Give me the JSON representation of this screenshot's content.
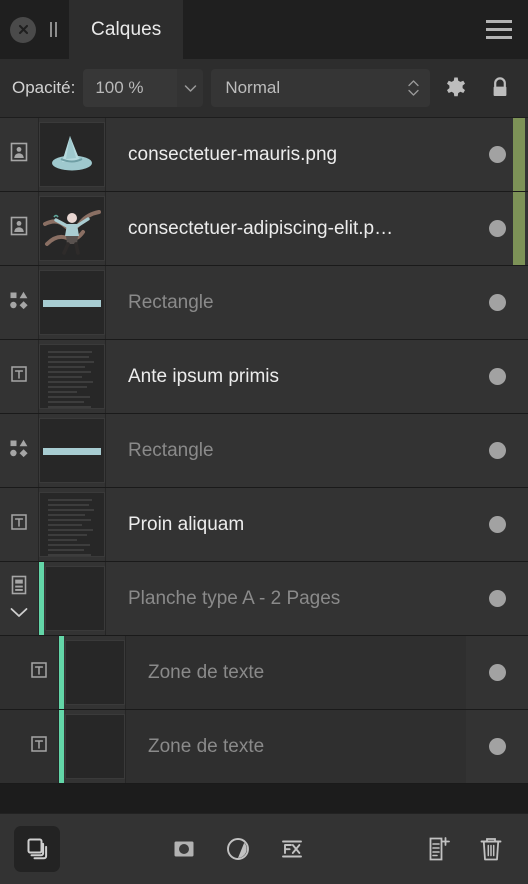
{
  "titlebar": {
    "close_icon": "close-circle-icon",
    "grip_icon": "drag-handle-icon",
    "tab_label": "Calques",
    "menu_icon": "hamburger-menu-icon"
  },
  "options": {
    "opacity_label": "Opacité:",
    "opacity_value": "100 %",
    "opacity_caret_icon": "chevron-down-icon",
    "blend_mode": "Normal",
    "blend_spinner_icon": "spinner-updown-icon",
    "settings_icon": "gear-icon",
    "lock_icon": "lock-icon"
  },
  "layers": [
    {
      "name": "consectetuer-mauris.png",
      "type_icon": "image-layer-icon",
      "thumb": "hat",
      "dim": false,
      "child": false,
      "accent": false,
      "edge_marker": true,
      "visible": true
    },
    {
      "name": "consectetuer-adipiscing-elit.p…",
      "type_icon": "image-layer-icon",
      "thumb": "figure",
      "dim": false,
      "child": false,
      "accent": false,
      "edge_marker": true,
      "visible": true
    },
    {
      "name": "Rectangle",
      "type_icon": "shape-layer-icon",
      "thumb": "bar",
      "dim": true,
      "child": false,
      "accent": false,
      "edge_marker": false,
      "visible": true
    },
    {
      "name": "Ante ipsum primis",
      "type_icon": "text-layer-icon",
      "thumb": "text",
      "dim": false,
      "child": false,
      "accent": false,
      "edge_marker": false,
      "visible": true
    },
    {
      "name": "Rectangle",
      "type_icon": "shape-layer-icon",
      "thumb": "bar",
      "dim": true,
      "child": false,
      "accent": false,
      "edge_marker": false,
      "visible": true
    },
    {
      "name": "Proin aliquam",
      "type_icon": "text-layer-icon",
      "thumb": "text",
      "dim": false,
      "child": false,
      "accent": false,
      "edge_marker": false,
      "visible": true
    },
    {
      "name": "Planche type A - 2 Pages",
      "type_icon": "master-page-icon",
      "thumb": "empty",
      "dim": true,
      "child": false,
      "accent": true,
      "expander_icon": "chevron-down-icon",
      "edge_marker": false,
      "visible": true
    },
    {
      "name": "Zone de texte",
      "type_icon": "text-layer-icon",
      "thumb": "empty",
      "dim": true,
      "child": true,
      "accent": true,
      "edge_marker": false,
      "visible": true
    },
    {
      "name": "Zone de texte",
      "type_icon": "text-layer-icon",
      "thumb": "empty",
      "dim": true,
      "child": true,
      "accent": true,
      "edge_marker": false,
      "visible": true
    }
  ],
  "bottombar": {
    "layers_mode_icon": "layers-stack-icon",
    "mask_icon": "add-mask-icon",
    "adjustment_icon": "adjustment-layer-icon",
    "fx_icon": "layer-effects-icon",
    "new_layer_icon": "new-layer-icon",
    "delete_icon": "trash-icon"
  },
  "colors": {
    "panel_bg": "#2d2d2d",
    "row_bg": "#333333",
    "accent_green": "#63d6a8",
    "edge_marker_green": "#7d9257",
    "thumb_accent": "#a8cdd2"
  }
}
